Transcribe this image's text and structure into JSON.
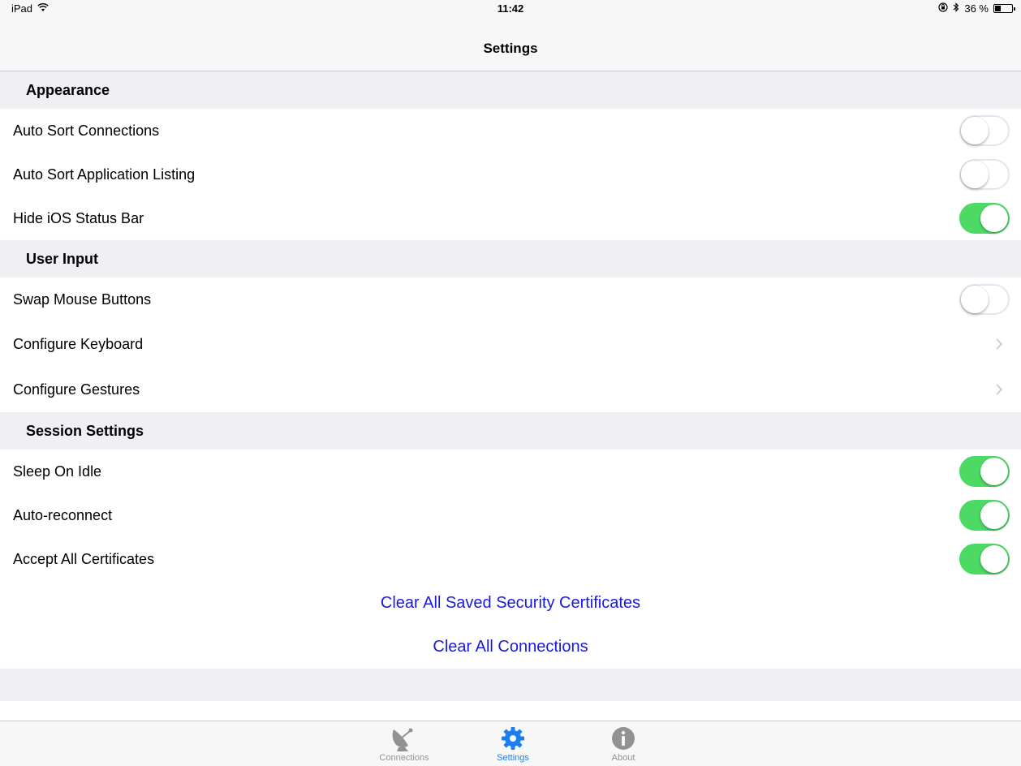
{
  "status_bar": {
    "device": "iPad",
    "time": "11:42",
    "battery": "36 %",
    "battery_level": 0.36
  },
  "nav": {
    "title": "Settings"
  },
  "sections": {
    "appearance": {
      "title": "Appearance",
      "rows": [
        {
          "label": "Auto Sort Connections",
          "on": false
        },
        {
          "label": "Auto Sort Application Listing",
          "on": false
        },
        {
          "label": "Hide iOS Status Bar",
          "on": true
        }
      ]
    },
    "user_input": {
      "title": "User Input",
      "rows": [
        {
          "label": "Swap Mouse Buttons",
          "on": false
        },
        {
          "label": "Configure Keyboard"
        },
        {
          "label": "Configure Gestures"
        }
      ]
    },
    "session": {
      "title": "Session Settings",
      "rows": [
        {
          "label": "Sleep On Idle",
          "on": true
        },
        {
          "label": "Auto-reconnect",
          "on": true
        },
        {
          "label": "Accept All Certificates",
          "on": true
        }
      ]
    }
  },
  "actions": {
    "clear_certificates": "Clear All Saved Security Certificates",
    "clear_connections": "Clear All Connections"
  },
  "tabs": [
    {
      "label": "Connections",
      "icon": "satellite-dish-icon",
      "active": false
    },
    {
      "label": "Settings",
      "icon": "gear-icon",
      "active": true
    },
    {
      "label": "About",
      "icon": "info-icon",
      "active": false
    }
  ],
  "colors": {
    "toggle_on": "#4cd964",
    "link": "#1a1adc",
    "tab_active": "#1a7ff0",
    "tab_inactive": "#929292"
  }
}
